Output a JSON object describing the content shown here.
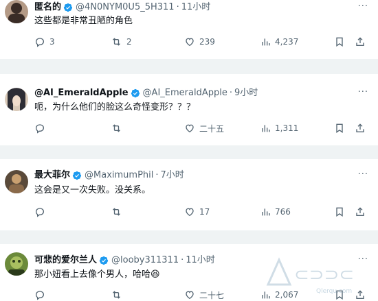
{
  "tweets": [
    {
      "name": "匿名的",
      "handle": "@4N0NYM0U5_5H311",
      "dot": "·",
      "time": "11小时",
      "text": "这些都是非常丑陋的角色",
      "replies": "3",
      "retweets": "2",
      "likes": "239",
      "views": "4,237",
      "avatar_colors": [
        "#b49a86",
        "#3a2c26"
      ]
    },
    {
      "name": "@AI_EmeraldApple",
      "handle": "@AI_EmeraldApple",
      "dot": "·",
      "time": "9小时",
      "text": "呃，为什么他们的脸这么奇怪变形？？？",
      "replies": "",
      "retweets": "",
      "likes": "二十五",
      "views": "1,311",
      "avatar_colors": [
        "#d9c9b8",
        "#2d2d35"
      ]
    },
    {
      "name": "最大菲尔",
      "handle": "@MaximumPhil",
      "dot": "·",
      "time": "7小时",
      "text": "这会是又一次失败。没关系。",
      "replies": "",
      "retweets": "",
      "likes": "17",
      "views": "766",
      "avatar_colors": [
        "#5a4a3a",
        "#c9a070"
      ]
    },
    {
      "name": "可悲的爱尔兰人",
      "handle": "@looby311311",
      "dot": "·",
      "time": "11小时",
      "text": "那小妞看上去像个男人，哈哈😆",
      "replies": "",
      "retweets": "",
      "likes": "二十七",
      "views": "2,067",
      "avatar_colors": [
        "#6b8a3a",
        "#2a3a1a"
      ]
    }
  ],
  "more_label": "···",
  "watermark": "Qlerqu.com",
  "colors": {
    "verified": "#1d9bf0",
    "muted": "#536471",
    "text": "#0f1419",
    "separator": "#eff3f4"
  }
}
